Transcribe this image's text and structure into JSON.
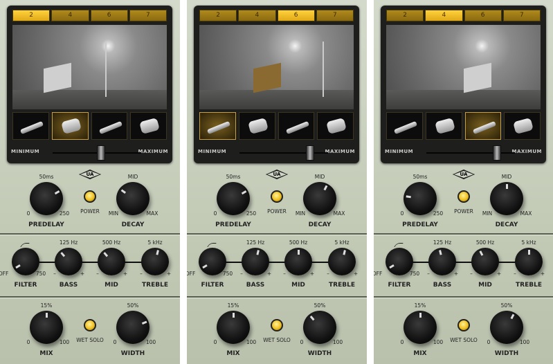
{
  "logo_text": "UA",
  "room_tabs": [
    "2",
    "4",
    "6",
    "7"
  ],
  "slider": {
    "min_label": "MINIMUM",
    "max_label": "MAXIMUM"
  },
  "reverb": {
    "predelay": {
      "value_label": "50ms",
      "min": "0",
      "max": "250",
      "label": "PREDELAY"
    },
    "power_label": "POWER",
    "decay": {
      "value_label": "MID",
      "min": "MIN",
      "max": "MAX",
      "label": "DECAY"
    }
  },
  "eq": {
    "filter": {
      "min": "OFF",
      "max": "750",
      "label": "FILTER"
    },
    "bass": {
      "value_label": "125 Hz",
      "min": "–",
      "max": "+",
      "label": "BASS"
    },
    "mid": {
      "value_label": "500 Hz",
      "min": "–",
      "max": "+",
      "label": "MID"
    },
    "treble": {
      "value_label": "5 kHz",
      "min": "–",
      "max": "+",
      "label": "TREBLE"
    }
  },
  "output": {
    "mix": {
      "value_label": "15%",
      "min": "0",
      "max": "100",
      "label": "MIX"
    },
    "wet_solo_label": "WET SOLO",
    "width": {
      "value_label": "50%",
      "min": "0",
      "max": "100",
      "label": "WIDTH"
    }
  },
  "colors": {
    "accent_gold": "#f0c020",
    "panel": "#c9d0bf",
    "display": "#1e1f1c"
  },
  "panels": [
    {
      "selected_room": "2",
      "selected_mic": 2,
      "mic_distance": 0.55,
      "knobs": {
        "predelay": 0.72,
        "decay": 0.3,
        "filter": 0.05,
        "bass": 0.35,
        "mid": 0.35,
        "treble": 0.55,
        "mix": 0.5,
        "width": 0.75
      }
    },
    {
      "selected_room": "6",
      "selected_mic": 1,
      "mic_distance": 0.8,
      "knobs": {
        "predelay": 0.72,
        "decay": 0.6,
        "filter": 0.05,
        "bass": 0.55,
        "mid": 0.5,
        "treble": 0.55,
        "mix": 0.5,
        "width": 0.35
      }
    },
    {
      "selected_room": "4",
      "selected_mic": 3,
      "mic_distance": 0.8,
      "knobs": {
        "predelay": 0.2,
        "decay": 0.5,
        "filter": 0.05,
        "bass": 0.45,
        "mid": 0.4,
        "treble": 0.5,
        "mix": 0.5,
        "width": 0.6
      }
    }
  ]
}
